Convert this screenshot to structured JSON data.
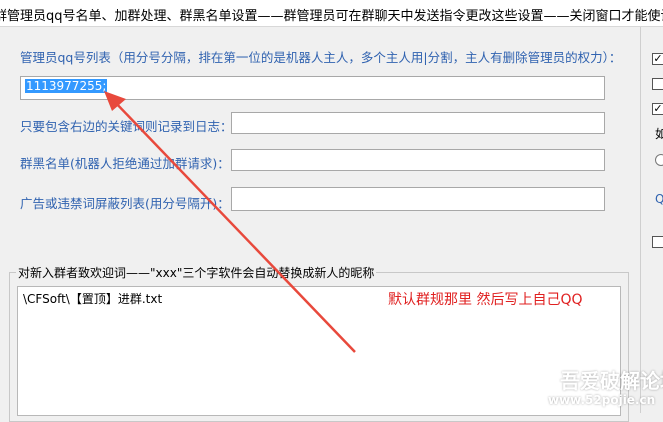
{
  "title": "群管理员qq号名单、加群处理、群黑名单设置——群管理员可在群聊天中发送指令更改这些设置——关闭窗口才能使设置生效",
  "admin_list": {
    "label": "管理员qq号列表（用分号分隔，排在第一位的是机器人主人，多个主人用|分割，主人有删除管理员的权力）：",
    "value": "1113977255;"
  },
  "log_keywords": {
    "label": "只要包含右边的关键词则记录到日志：",
    "value": ""
  },
  "blacklist": {
    "label": "群黑名单(机器人拒绝通过加群请求)：",
    "value": ""
  },
  "ad_filter": {
    "label": "广告或违禁词屏蔽列表(用分号隔开)：",
    "value": ""
  },
  "welcome": {
    "legend": "对新入群者致欢迎词——\"xxx\"三个字软件会自动替换成新人的昵称",
    "text": "\\CFSoft\\【置顶】进群.txt"
  },
  "annotation": "默认群规那里 然后写上自己QQ",
  "right_pane": {
    "cb1": "✓",
    "cb2": "",
    "cb3": "✓",
    "text_ru": "如",
    "text_q": "Q",
    "cb4": ""
  },
  "watermark": {
    "line1": "吾爱破解论坛",
    "line2": "www.52pojie.cn"
  },
  "colors": {
    "label_blue": "#3163b0",
    "selection": "#3399ff",
    "annotation_red": "#e02020",
    "arrow_red": "#e8493c"
  }
}
